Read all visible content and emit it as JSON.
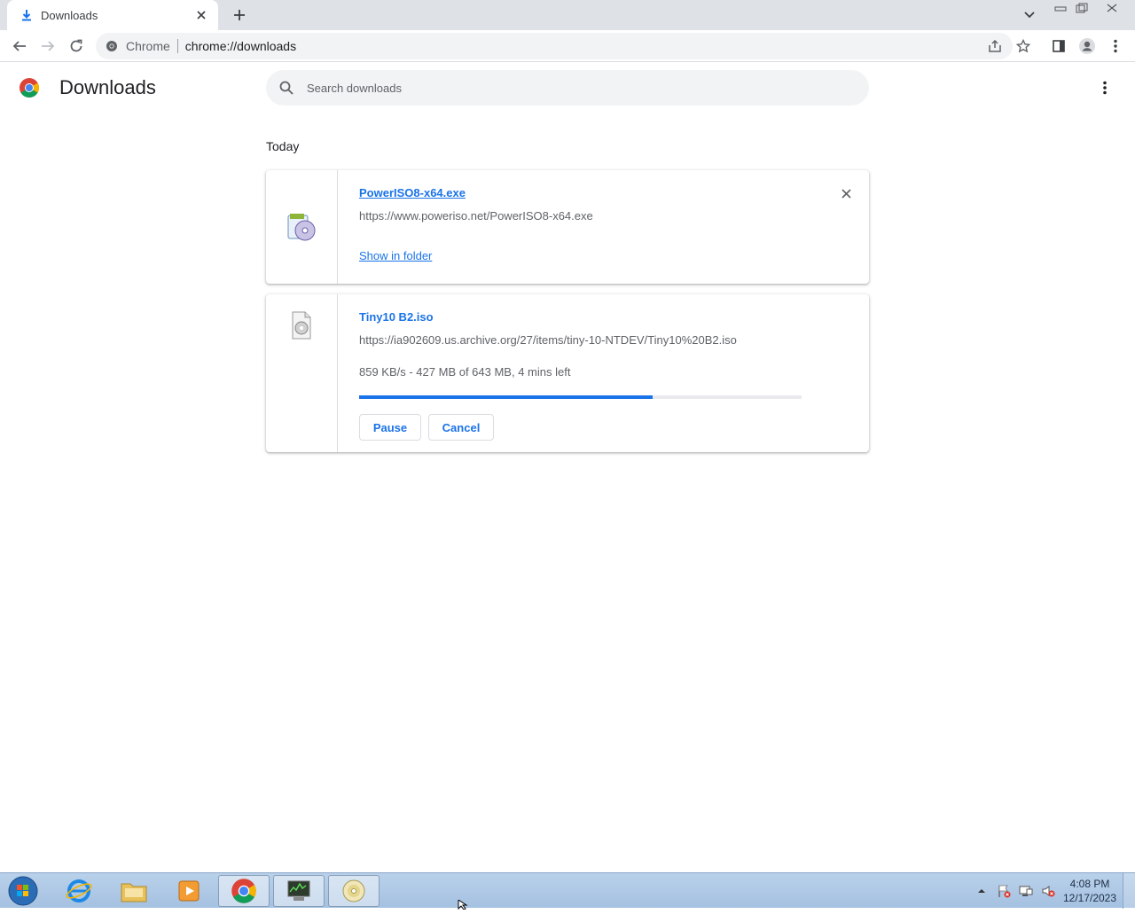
{
  "browser": {
    "tab_title": "Downloads",
    "site_name": "Chrome",
    "url": "chrome://downloads"
  },
  "header": {
    "title": "Downloads",
    "search_placeholder": "Search downloads"
  },
  "section_label": "Today",
  "downloads": [
    {
      "filename": "PowerISO8-x64.exe",
      "url": "https://www.poweriso.net/PowerISO8-x64.exe",
      "action": "Show in folder"
    },
    {
      "filename": "Tiny10 B2.iso",
      "url": "https://ia902609.us.archive.org/27/items/tiny-10-NTDEV/Tiny10%20B2.iso",
      "status": "859 KB/s - 427 MB of 643 MB, 4 mins left",
      "progress": 0.664,
      "pause_label": "Pause",
      "cancel_label": "Cancel"
    }
  ],
  "taskbar": {
    "time": "4:08 PM",
    "date": "12/17/2023"
  },
  "colors": {
    "accent": "#1a73e8",
    "tabstrip": "#dee1e6",
    "omnibox": "#f1f3f4"
  }
}
